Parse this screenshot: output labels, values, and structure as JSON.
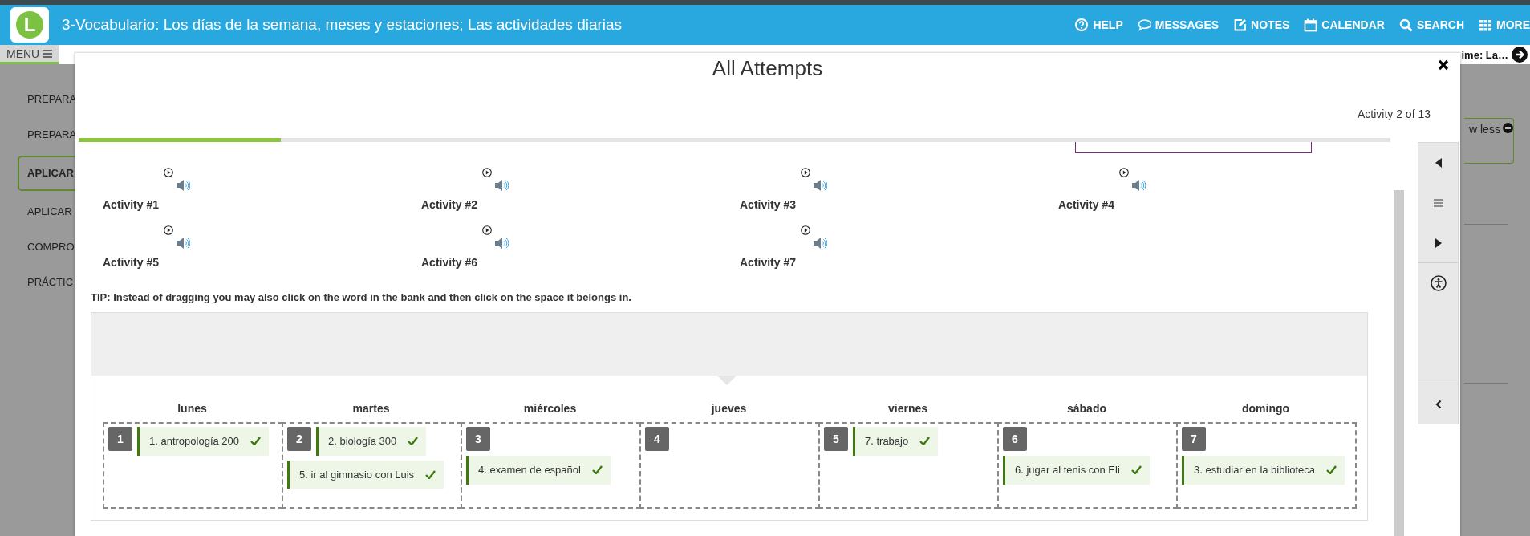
{
  "app_bar": {
    "logo_letter": "L",
    "title": "3-Vocabulario: Los días de la semana, meses y estaciones; Las actividades diarias",
    "nav": [
      {
        "kind": "help",
        "label": "HELP"
      },
      {
        "kind": "messages",
        "label": "MESSAGES"
      },
      {
        "kind": "notes",
        "label": "NOTES"
      },
      {
        "kind": "calendar",
        "label": "CALENDAR"
      },
      {
        "kind": "search",
        "label": "SEARCH"
      },
      {
        "kind": "more",
        "label": "MORE"
      }
    ]
  },
  "sub_bar": {
    "menu_label": "MENU",
    "right_text": "ime: La…"
  },
  "sidebar": {
    "items": [
      {
        "label": "PREPARA",
        "selected": false
      },
      {
        "label": "PREPARA",
        "selected": false
      },
      {
        "label": "APLICAR",
        "selected": true
      },
      {
        "label": "APLICAR",
        "selected": false
      },
      {
        "label": "COMPRO",
        "selected": false
      },
      {
        "label": "PRÁCTIC",
        "selected": false
      }
    ]
  },
  "side_panel": {
    "toggle_label": "w less"
  },
  "modal": {
    "title": "All Attempts",
    "counter": "Activity 2 of 13",
    "progress": {
      "level": 0.154
    },
    "activities": [
      {
        "label": "Activity #1"
      },
      {
        "label": "Activity #2"
      },
      {
        "label": "Activity #3"
      },
      {
        "label": "Activity #4"
      },
      {
        "label": "Activity #5"
      },
      {
        "label": "Activity #6"
      },
      {
        "label": "Activity #7"
      }
    ],
    "tip": "TIP: Instead of dragging you may also click on the word in the bank and then click on the space it belongs in.",
    "days": [
      {
        "name": "lunes",
        "number": "1",
        "items": [
          {
            "text": "1. antropología 200",
            "correct": true
          }
        ]
      },
      {
        "name": "martes",
        "number": "2",
        "items": [
          {
            "text": "2. biología 300",
            "correct": true
          },
          {
            "text": "5. ir al gimnasio con Luis",
            "correct": true
          }
        ]
      },
      {
        "name": "miércoles",
        "number": "3",
        "items": [
          {
            "text": "4. examen de español",
            "correct": true
          }
        ]
      },
      {
        "name": "jueves",
        "number": "4"
      },
      {
        "name": "viernes",
        "number": "5",
        "items": [
          {
            "text": "7. trabajo",
            "correct": true
          }
        ]
      },
      {
        "name": "sábado",
        "number": "6",
        "items": [
          {
            "text": "6. jugar al tenis con Eli",
            "correct": true
          }
        ]
      },
      {
        "name": "domingo",
        "number": "7",
        "items": [
          {
            "text": "3. estudiar en la biblioteca",
            "correct": true
          }
        ]
      }
    ]
  }
}
